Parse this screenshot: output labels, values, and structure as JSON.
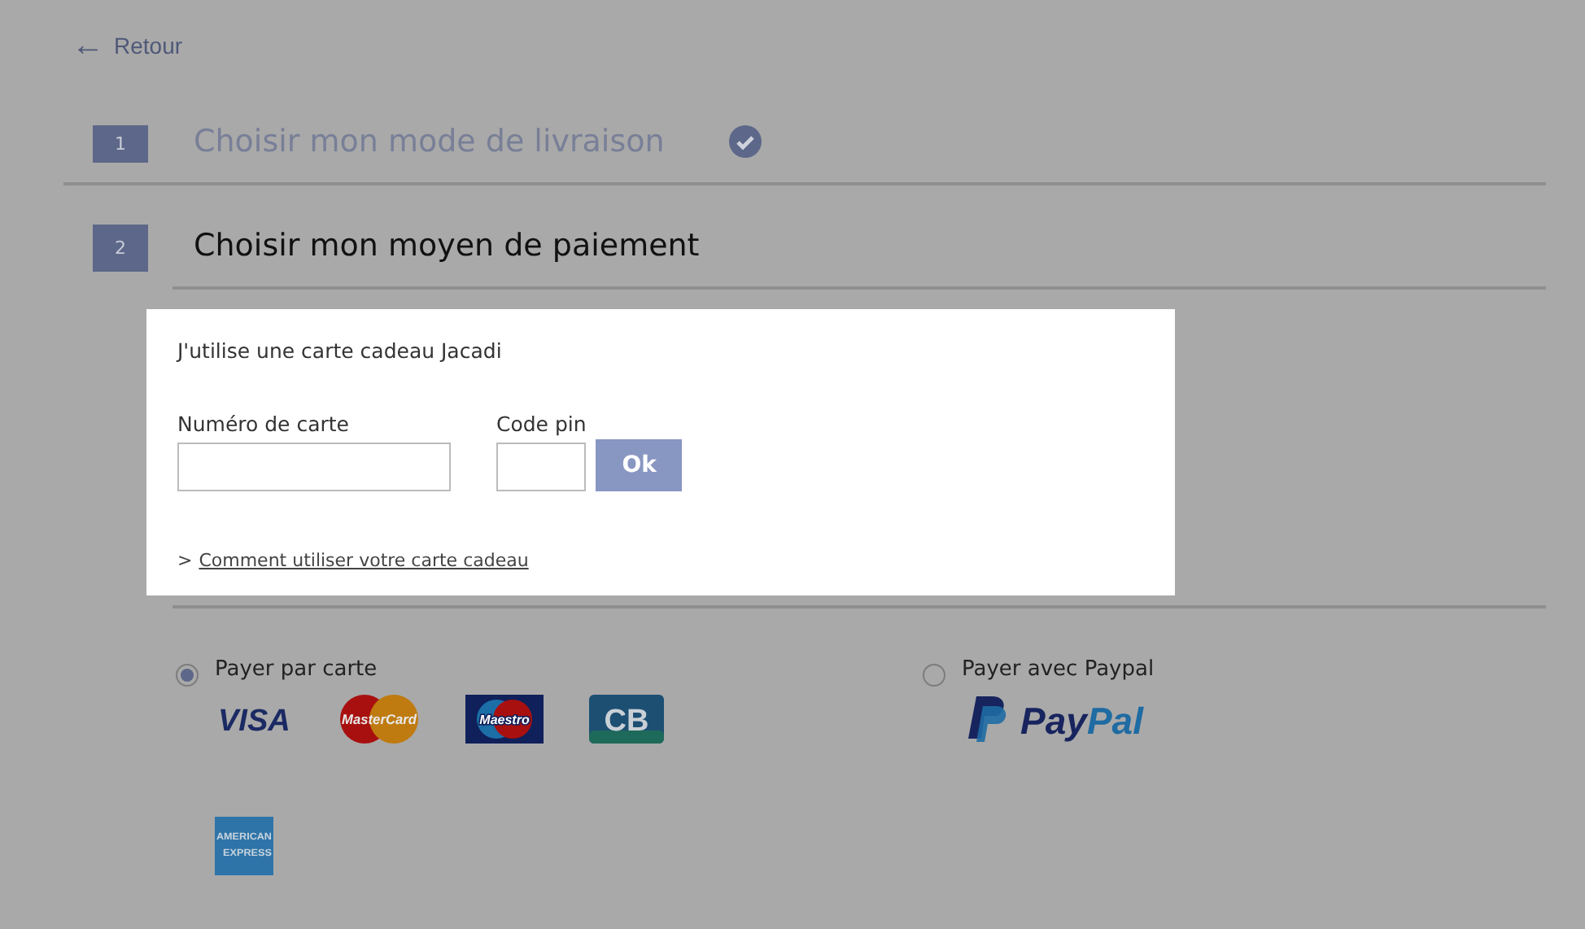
{
  "back_link": {
    "icon": "←",
    "label": "Retour"
  },
  "steps": [
    {
      "number": "1",
      "title": "Choisir mon mode de livraison",
      "completed": true,
      "active": false
    },
    {
      "number": "2",
      "title": "Choisir mon moyen de paiement",
      "completed": false,
      "active": true
    }
  ],
  "gift_card_dialog": {
    "title": "J'utilise une carte cadeau Jacadi",
    "card_number": {
      "label": "Numéro de carte"
    },
    "pin": {
      "label": "Code pin"
    },
    "submit": "Ok",
    "help_prefix": ">",
    "help_link": "Comment utiliser votre carte cadeau"
  },
  "payment_methods": [
    {
      "label": "Payer par carte",
      "selected": true,
      "logos": [
        {
          "kind": "visa",
          "text": "VISA"
        },
        {
          "kind": "mastercard",
          "text": "MasterCard"
        },
        {
          "kind": "maestro",
          "text": "Maestro"
        },
        {
          "kind": "cb",
          "text": "CB"
        },
        {
          "kind": "amex",
          "text": "AMERICAN EXPRESS"
        }
      ]
    },
    {
      "label": "Payer avec Paypal",
      "selected": false,
      "logos": [
        {
          "kind": "paypal",
          "text": "PayPal"
        }
      ]
    }
  ]
}
